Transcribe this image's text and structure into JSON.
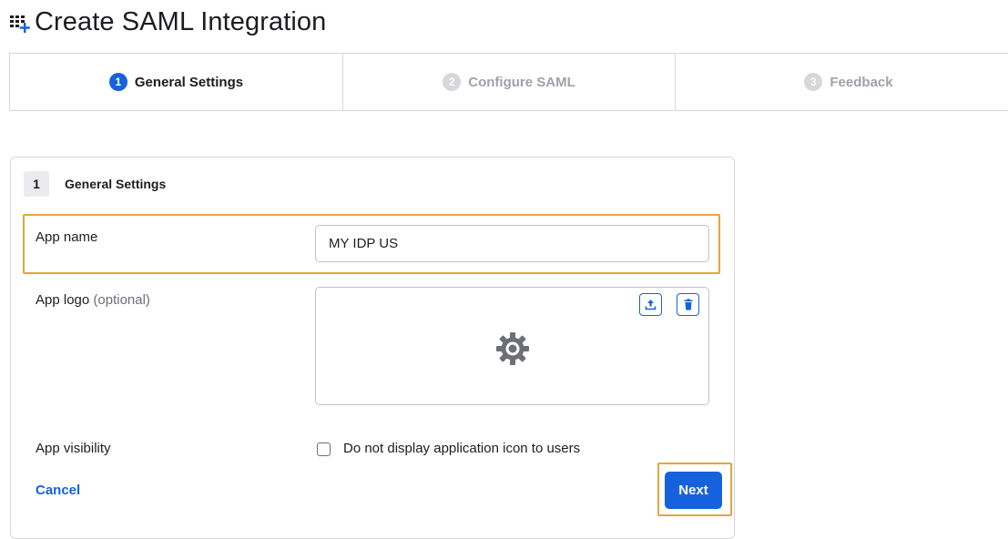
{
  "page": {
    "title": "Create SAML Integration",
    "icon": "add-app-grid-icon"
  },
  "stepper": {
    "steps": [
      {
        "number": "1",
        "label": "General Settings",
        "state": "active"
      },
      {
        "number": "2",
        "label": "Configure SAML",
        "state": "inactive"
      },
      {
        "number": "3",
        "label": "Feedback",
        "state": "inactive"
      }
    ]
  },
  "section": {
    "number": "1",
    "title": "General Settings"
  },
  "form": {
    "app_name": {
      "label": "App name",
      "value": "MY IDP US"
    },
    "app_logo": {
      "label": "App logo",
      "optional": "(optional)",
      "upload_icon": "upload-icon",
      "delete_icon": "trash-icon",
      "placeholder_icon": "gear-icon"
    },
    "app_visibility": {
      "label": "App visibility",
      "checkbox_label": "Do not display application icon to users",
      "checked": false
    }
  },
  "actions": {
    "cancel": "Cancel",
    "next": "Next"
  },
  "colors": {
    "primary": "#1662dd",
    "highlight": "#e8a438",
    "border": "#d7d7dc",
    "muted": "#a0a0a8"
  }
}
